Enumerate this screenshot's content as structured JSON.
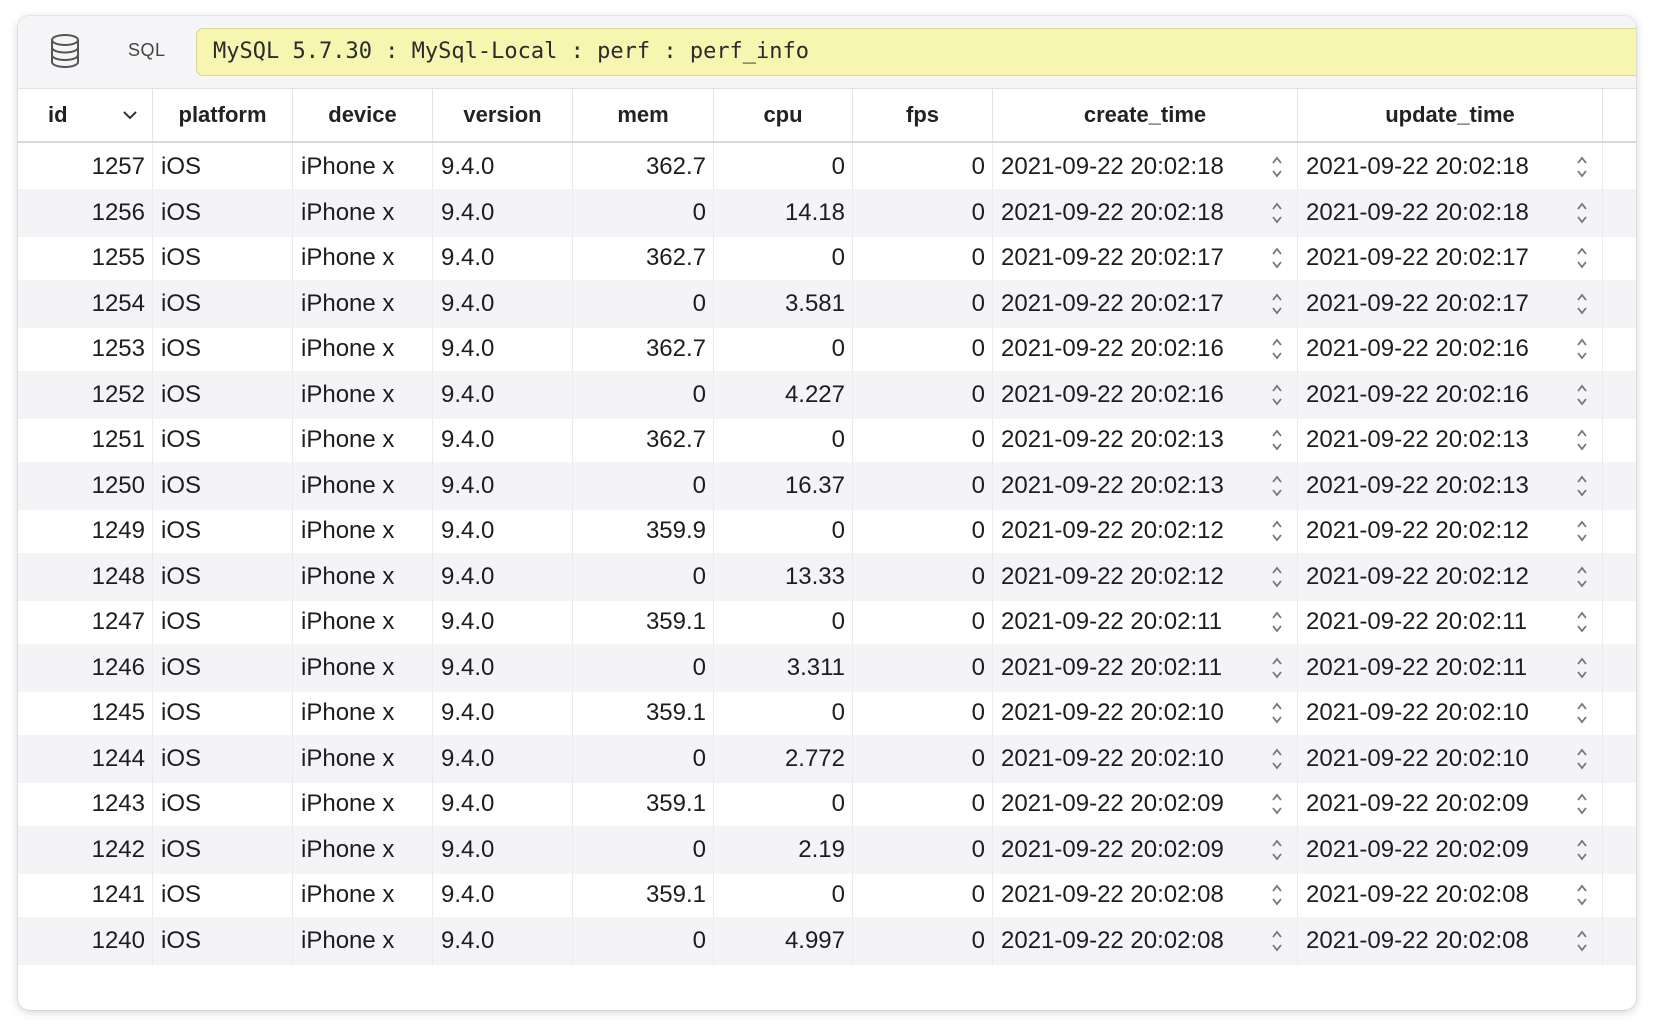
{
  "toolbar": {
    "db_icon": "database-icon",
    "sql_label": "SQL",
    "connection": "MySQL 5.7.30 : MySql-Local : perf : perf_info"
  },
  "table": {
    "columns": [
      "id",
      "platform",
      "device",
      "version",
      "mem",
      "cpu",
      "fps",
      "create_time",
      "update_time"
    ],
    "sort_column": "id",
    "sort_icon": "chevron-down-icon",
    "rows": [
      [
        "1257",
        "iOS",
        "iPhone x",
        "9.4.0",
        "362.7",
        "0",
        "0",
        "2021-09-22 20:02:18",
        "2021-09-22 20:02:18"
      ],
      [
        "1256",
        "iOS",
        "iPhone x",
        "9.4.0",
        "0",
        "14.18",
        "0",
        "2021-09-22 20:02:18",
        "2021-09-22 20:02:18"
      ],
      [
        "1255",
        "iOS",
        "iPhone x",
        "9.4.0",
        "362.7",
        "0",
        "0",
        "2021-09-22 20:02:17",
        "2021-09-22 20:02:17"
      ],
      [
        "1254",
        "iOS",
        "iPhone x",
        "9.4.0",
        "0",
        "3.581",
        "0",
        "2021-09-22 20:02:17",
        "2021-09-22 20:02:17"
      ],
      [
        "1253",
        "iOS",
        "iPhone x",
        "9.4.0",
        "362.7",
        "0",
        "0",
        "2021-09-22 20:02:16",
        "2021-09-22 20:02:16"
      ],
      [
        "1252",
        "iOS",
        "iPhone x",
        "9.4.0",
        "0",
        "4.227",
        "0",
        "2021-09-22 20:02:16",
        "2021-09-22 20:02:16"
      ],
      [
        "1251",
        "iOS",
        "iPhone x",
        "9.4.0",
        "362.7",
        "0",
        "0",
        "2021-09-22 20:02:13",
        "2021-09-22 20:02:13"
      ],
      [
        "1250",
        "iOS",
        "iPhone x",
        "9.4.0",
        "0",
        "16.37",
        "0",
        "2021-09-22 20:02:13",
        "2021-09-22 20:02:13"
      ],
      [
        "1249",
        "iOS",
        "iPhone x",
        "9.4.0",
        "359.9",
        "0",
        "0",
        "2021-09-22 20:02:12",
        "2021-09-22 20:02:12"
      ],
      [
        "1248",
        "iOS",
        "iPhone x",
        "9.4.0",
        "0",
        "13.33",
        "0",
        "2021-09-22 20:02:12",
        "2021-09-22 20:02:12"
      ],
      [
        "1247",
        "iOS",
        "iPhone x",
        "9.4.0",
        "359.1",
        "0",
        "0",
        "2021-09-22 20:02:11",
        "2021-09-22 20:02:11"
      ],
      [
        "1246",
        "iOS",
        "iPhone x",
        "9.4.0",
        "0",
        "3.311",
        "0",
        "2021-09-22 20:02:11",
        "2021-09-22 20:02:11"
      ],
      [
        "1245",
        "iOS",
        "iPhone x",
        "9.4.0",
        "359.1",
        "0",
        "0",
        "2021-09-22 20:02:10",
        "2021-09-22 20:02:10"
      ],
      [
        "1244",
        "iOS",
        "iPhone x",
        "9.4.0",
        "0",
        "2.772",
        "0",
        "2021-09-22 20:02:10",
        "2021-09-22 20:02:10"
      ],
      [
        "1243",
        "iOS",
        "iPhone x",
        "9.4.0",
        "359.1",
        "0",
        "0",
        "2021-09-22 20:02:09",
        "2021-09-22 20:02:09"
      ],
      [
        "1242",
        "iOS",
        "iPhone x",
        "9.4.0",
        "0",
        "2.19",
        "0",
        "2021-09-22 20:02:09",
        "2021-09-22 20:02:09"
      ],
      [
        "1241",
        "iOS",
        "iPhone x",
        "9.4.0",
        "359.1",
        "0",
        "0",
        "2021-09-22 20:02:08",
        "2021-09-22 20:02:08"
      ],
      [
        "1240",
        "iOS",
        "iPhone x",
        "9.4.0",
        "0",
        "4.997",
        "0",
        "2021-09-22 20:02:08",
        "2021-09-22 20:02:08"
      ]
    ]
  },
  "colors": {
    "connection_bar": "#f6f6b0",
    "row_alt": "#f4f4f6",
    "header_border": "#d8d8da"
  }
}
